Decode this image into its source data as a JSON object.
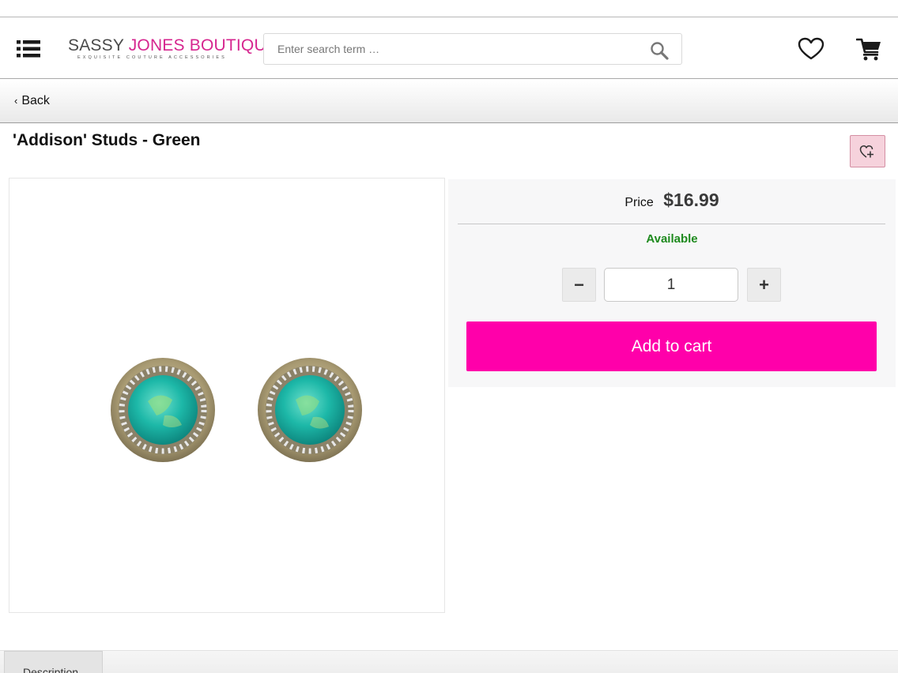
{
  "header": {
    "logo": {
      "primary": "SASSY",
      "secondary": "JONES BOUTIQUE",
      "tagline": "Exquisite Couture Accessories"
    },
    "search": {
      "placeholder": "Enter search term …",
      "value": ""
    },
    "icons": {
      "menu": "list-menu-icon",
      "search": "magnifier-icon",
      "wishlist": "heart-icon",
      "cart": "shopping-cart-icon"
    }
  },
  "nav": {
    "back_label": "Back"
  },
  "product": {
    "title": "'Addison' Studs - Green",
    "price_label": "Price",
    "price": "$16.99",
    "availability": "Available",
    "quantity": "1",
    "add_to_cart_label": "Add to cart",
    "image_description": "pair of round green opal stud earrings with crystal halo"
  },
  "tabs": [
    {
      "label": "Description"
    }
  ],
  "colors": {
    "brand_pink": "#ff00aa",
    "logo_pink": "#d6268f",
    "available_green": "#1e8a1e",
    "wishlist_button_bg": "#f6d2dc"
  }
}
